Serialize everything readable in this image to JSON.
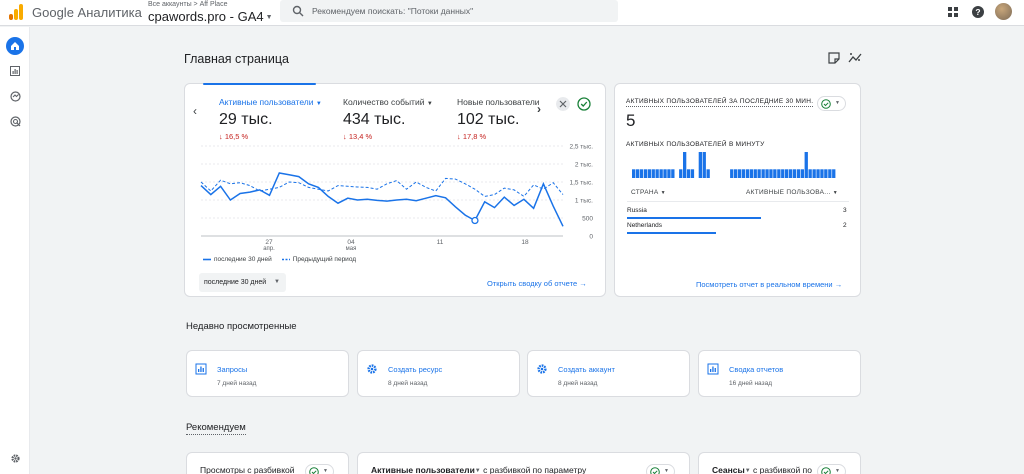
{
  "app": {
    "brand": "Google Аналитика",
    "breadcrumb": "Все аккаунты > Aff Place",
    "account": "cpawords.pro - GA4"
  },
  "search": {
    "placeholder": "Рекомендуем поискать: \"Потоки данных\""
  },
  "page": {
    "title": "Главная страница"
  },
  "metrics": [
    {
      "label": "Активные пользователи",
      "value": "29 тыс.",
      "delta": "16,5 %"
    },
    {
      "label": "Количество событий",
      "value": "434 тыс.",
      "delta": "13,4 %"
    },
    {
      "label": "Новые пользователи",
      "value": "102 тыс.",
      "delta": "17,8 %"
    }
  ],
  "chart_data": {
    "type": "line",
    "title": "Активные пользователи",
    "y_ticks": [
      "2,5 тыс.",
      "2 тыс.",
      "1,5 тыс.",
      "1 тыс.",
      "500",
      "0"
    ],
    "x_ticks": [
      {
        "day": "27",
        "month": "апр."
      },
      {
        "day": "04",
        "month": "мая"
      },
      {
        "day": "11",
        "month": ""
      },
      {
        "day": "18",
        "month": ""
      }
    ],
    "ylim": [
      0,
      2500
    ],
    "series": [
      {
        "name": "последние 30 дней",
        "style": "solid",
        "color": "#1a73e8",
        "values": [
          1400,
          1150,
          1380,
          1000,
          1180,
          1220,
          1280,
          1130,
          1750,
          1700,
          1650,
          1450,
          1350,
          1100,
          910,
          1050,
          1000,
          1020,
          990,
          970,
          1000,
          1020,
          980,
          1050,
          1120,
          1060,
          810,
          580,
          430,
          950,
          790,
          1080,
          850,
          1020,
          770,
          1450,
          830,
          270
        ]
      },
      {
        "name": "Предыдущий период",
        "style": "dashed",
        "color": "#1a73e8",
        "values": [
          1500,
          1250,
          1550,
          1450,
          1480,
          1400,
          1250,
          1300,
          1350,
          1500,
          1480,
          1350,
          1300,
          1250,
          1400,
          1380,
          1360,
          1350,
          1300,
          1450,
          1540,
          1300,
          1500,
          1350,
          1250,
          1600,
          1580,
          1450,
          1300,
          1100,
          1150,
          1330,
          1280,
          1100,
          1420,
          1300,
          1480,
          1150
        ]
      }
    ],
    "legend": [
      "последние 30 дней",
      "Предыдущий период"
    ]
  },
  "controls": {
    "range": "последние 30 дней",
    "report_link": "Открыть сводку об отчете"
  },
  "realtime": {
    "title": "АКТИВНЫХ ПОЛЬЗОВАТЕЛЕЙ ЗА ПОСЛЕДНИЕ 30 МИН.",
    "value": "5",
    "per_minute_label": "АКТИВНЫХ ПОЛЬЗОВАТЕЛЕЙ В МИНУТУ",
    "per_minute": [
      1,
      1,
      1,
      1,
      1,
      1,
      1,
      1,
      1,
      1,
      1,
      0,
      1,
      3,
      1,
      1,
      0,
      3,
      3,
      1,
      0,
      0,
      0,
      0,
      0,
      1,
      1,
      1,
      1,
      1,
      1,
      1,
      1,
      1,
      1,
      1,
      1,
      1,
      1,
      1,
      1,
      1,
      1,
      1,
      3,
      1,
      1,
      1,
      1,
      1,
      1,
      1
    ],
    "col_country": "СТРАНА",
    "col_users": "АКТИВНЫЕ ПОЛЬЗОВА...",
    "rows": [
      {
        "country": "Russia",
        "users": 3
      },
      {
        "country": "Netherlands",
        "users": 2
      }
    ],
    "link": "Посмотреть отчет в реальном времени"
  },
  "recent": {
    "title": "Недавно просмотренные",
    "items": [
      {
        "name": "Запросы",
        "time": "7 дней назад",
        "icon": "report-icon"
      },
      {
        "name": "Создать ресурс",
        "time": "8 дней назад",
        "icon": "gear-icon"
      },
      {
        "name": "Создать аккаунт",
        "time": "8 дней назад",
        "icon": "gear-icon"
      },
      {
        "name": "Сводка отчетов",
        "time": "16 дней назад",
        "icon": "report-icon"
      }
    ]
  },
  "recommended": {
    "title": "Рекомендуем",
    "items": [
      {
        "bold": "",
        "text": "Просмотры с разбивкой"
      },
      {
        "bold": "Активные пользователи",
        "text": "с разбивкой по параметру"
      },
      {
        "bold": "Сеансы",
        "text": "с разбивкой по"
      }
    ]
  },
  "colors": {
    "accent": "#1a73e8",
    "negative": "#c5221f",
    "positive": "#188038"
  }
}
